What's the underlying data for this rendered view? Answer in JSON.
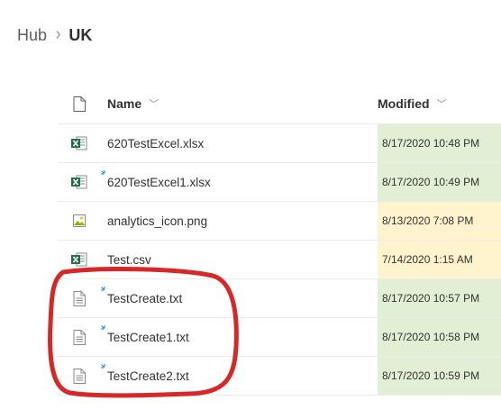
{
  "breadcrumb": {
    "parent": "Hub",
    "separator": "›",
    "current": "UK"
  },
  "columns": {
    "type_icon": "document-icon",
    "name_label": "Name",
    "modified_label": "Modified"
  },
  "colors": {
    "recent_highlight": "#e1f0d5",
    "older_highlight": "#fff4ce",
    "annotation_red": "#d62828",
    "excel_green": "#1e7145",
    "new_indicator": "#0078d4"
  },
  "files": [
    {
      "name": "620TestExcel.xlsx",
      "modified": "8/17/2020 10:48 PM",
      "icon": "excel-icon",
      "is_new": false,
      "highlight": "green"
    },
    {
      "name": "620TestExcel1.xlsx",
      "modified": "8/17/2020 10:49 PM",
      "icon": "excel-icon",
      "is_new": true,
      "highlight": "green"
    },
    {
      "name": "analytics_icon.png",
      "modified": "8/13/2020 7:08 PM",
      "icon": "image-icon",
      "is_new": false,
      "highlight": "yellow"
    },
    {
      "name": "Test.csv",
      "modified": "7/14/2020 1:15 AM",
      "icon": "excel-icon",
      "is_new": false,
      "highlight": "yellow"
    },
    {
      "name": "TestCreate.txt",
      "modified": "8/17/2020 10:57 PM",
      "icon": "text-file-icon",
      "is_new": true,
      "highlight": "green"
    },
    {
      "name": "TestCreate1.txt",
      "modified": "8/17/2020 10:58 PM",
      "icon": "text-file-icon",
      "is_new": true,
      "highlight": "green"
    },
    {
      "name": "TestCreate2.txt",
      "modified": "8/17/2020 10:59 PM",
      "icon": "text-file-icon",
      "is_new": true,
      "highlight": "green"
    }
  ]
}
